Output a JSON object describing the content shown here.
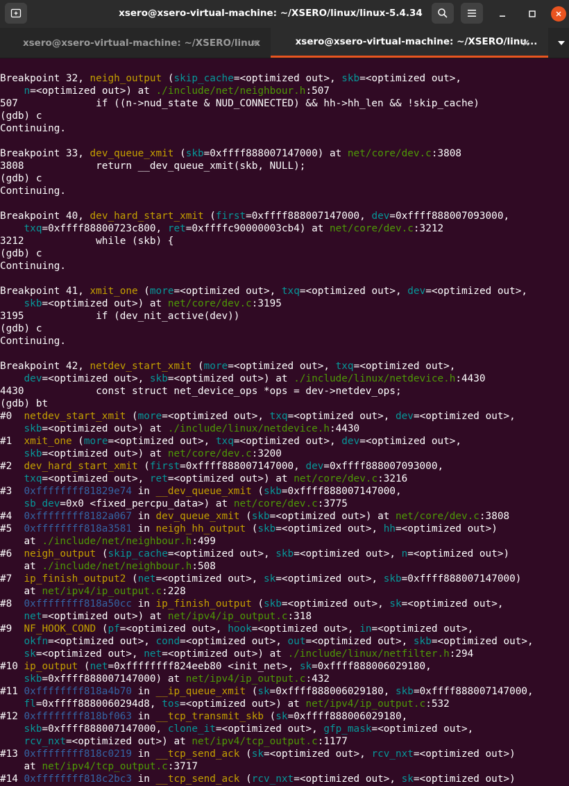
{
  "window": {
    "title": "xsero@xsero-virtual-machine: ~/XSERO/linux/linux-5.4.34",
    "new_tab_icon": "new-tab-icon",
    "search_icon": "search-icon",
    "menu_icon": "hamburger-menu-icon",
    "minimize_icon": "minimize-icon",
    "maximize_icon": "maximize-icon",
    "close_icon": "close-icon",
    "close_color": "#e95420"
  },
  "tabs": [
    {
      "label": "xsero@xsero-virtual-machine: ~/XSERO/linux",
      "close": "×",
      "active": false
    },
    {
      "label": "xsero@xsero-virtual-machine: ~/XSERO/linu...",
      "close": "×",
      "active": true
    }
  ],
  "tab_dropdown_icon": "chevron-down-icon",
  "terminal": {
    "colors": {
      "background": "#300a24",
      "text": "#ffffff",
      "function": "#c4a000",
      "argument": "#06989a",
      "file": "#4e9a06",
      "address": "#3465a4"
    },
    "lines": [
      [
        {
          "t": "Breakpoint 32, "
        },
        {
          "t": "neigh_output",
          "c": "fn"
        },
        {
          "t": " ("
        },
        {
          "t": "skip_cache",
          "c": "arg"
        },
        {
          "t": "=<optimized out>, "
        },
        {
          "t": "skb",
          "c": "arg"
        },
        {
          "t": "=<optimized out>,"
        }
      ],
      [
        {
          "t": "    "
        },
        {
          "t": "n",
          "c": "arg"
        },
        {
          "t": "=<optimized out>) at "
        },
        {
          "t": "./include/net/neighbour.h",
          "c": "file"
        },
        {
          "t": ":507"
        }
      ],
      [
        {
          "t": "507             if ((n->nud_state & NUD_CONNECTED) && hh->hh_len && !skip_cache)"
        }
      ],
      [
        {
          "t": "(gdb) c"
        }
      ],
      [
        {
          "t": "Continuing."
        }
      ],
      [
        {
          "t": ""
        }
      ],
      [
        {
          "t": "Breakpoint 33, "
        },
        {
          "t": "dev_queue_xmit",
          "c": "fn"
        },
        {
          "t": " ("
        },
        {
          "t": "skb",
          "c": "arg"
        },
        {
          "t": "=0xffff888007147000) at "
        },
        {
          "t": "net/core/dev.c",
          "c": "file"
        },
        {
          "t": ":3808"
        }
      ],
      [
        {
          "t": "3808            return __dev_queue_xmit(skb, NULL);"
        }
      ],
      [
        {
          "t": "(gdb) c"
        }
      ],
      [
        {
          "t": "Continuing."
        }
      ],
      [
        {
          "t": ""
        }
      ],
      [
        {
          "t": "Breakpoint 40, "
        },
        {
          "t": "dev_hard_start_xmit",
          "c": "fn"
        },
        {
          "t": " ("
        },
        {
          "t": "first",
          "c": "arg"
        },
        {
          "t": "=0xffff888007147000, "
        },
        {
          "t": "dev",
          "c": "arg"
        },
        {
          "t": "=0xffff888007093000,"
        }
      ],
      [
        {
          "t": "    "
        },
        {
          "t": "txq",
          "c": "arg"
        },
        {
          "t": "=0xffff88800723c800, "
        },
        {
          "t": "ret",
          "c": "arg"
        },
        {
          "t": "=0xffffc90000003cb4) at "
        },
        {
          "t": "net/core/dev.c",
          "c": "file"
        },
        {
          "t": ":3212"
        }
      ],
      [
        {
          "t": "3212            while (skb) {"
        }
      ],
      [
        {
          "t": "(gdb) c"
        }
      ],
      [
        {
          "t": "Continuing."
        }
      ],
      [
        {
          "t": ""
        }
      ],
      [
        {
          "t": "Breakpoint 41, "
        },
        {
          "t": "xmit_one",
          "c": "fn"
        },
        {
          "t": " ("
        },
        {
          "t": "more",
          "c": "arg"
        },
        {
          "t": "=<optimized out>, "
        },
        {
          "t": "txq",
          "c": "arg"
        },
        {
          "t": "=<optimized out>, "
        },
        {
          "t": "dev",
          "c": "arg"
        },
        {
          "t": "=<optimized out>,"
        }
      ],
      [
        {
          "t": "    "
        },
        {
          "t": "skb",
          "c": "arg"
        },
        {
          "t": "=<optimized out>) at "
        },
        {
          "t": "net/core/dev.c",
          "c": "file"
        },
        {
          "t": ":3195"
        }
      ],
      [
        {
          "t": "3195            if (dev_nit_active(dev))"
        }
      ],
      [
        {
          "t": "(gdb) c"
        }
      ],
      [
        {
          "t": "Continuing."
        }
      ],
      [
        {
          "t": ""
        }
      ],
      [
        {
          "t": "Breakpoint 42, "
        },
        {
          "t": "netdev_start_xmit",
          "c": "fn"
        },
        {
          "t": " ("
        },
        {
          "t": "more",
          "c": "arg"
        },
        {
          "t": "=<optimized out>, "
        },
        {
          "t": "txq",
          "c": "arg"
        },
        {
          "t": "=<optimized out>,"
        }
      ],
      [
        {
          "t": "    "
        },
        {
          "t": "dev",
          "c": "arg"
        },
        {
          "t": "=<optimized out>, "
        },
        {
          "t": "skb",
          "c": "arg"
        },
        {
          "t": "=<optimized out>) at "
        },
        {
          "t": "./include/linux/netdevice.h",
          "c": "file"
        },
        {
          "t": ":4430"
        }
      ],
      [
        {
          "t": "4430            const struct net_device_ops *ops = dev->netdev_ops;"
        }
      ],
      [
        {
          "t": "(gdb) bt"
        }
      ],
      [
        {
          "t": "#0  "
        },
        {
          "t": "netdev_start_xmit",
          "c": "fn"
        },
        {
          "t": " ("
        },
        {
          "t": "more",
          "c": "arg"
        },
        {
          "t": "=<optimized out>, "
        },
        {
          "t": "txq",
          "c": "arg"
        },
        {
          "t": "=<optimized out>, "
        },
        {
          "t": "dev",
          "c": "arg"
        },
        {
          "t": "=<optimized out>,"
        }
      ],
      [
        {
          "t": "    "
        },
        {
          "t": "skb",
          "c": "arg"
        },
        {
          "t": "=<optimized out>) at "
        },
        {
          "t": "./include/linux/netdevice.h",
          "c": "file"
        },
        {
          "t": ":4430"
        }
      ],
      [
        {
          "t": "#1  "
        },
        {
          "t": "xmit_one",
          "c": "fn"
        },
        {
          "t": " ("
        },
        {
          "t": "more",
          "c": "arg"
        },
        {
          "t": "=<optimized out>, "
        },
        {
          "t": "txq",
          "c": "arg"
        },
        {
          "t": "=<optimized out>, "
        },
        {
          "t": "dev",
          "c": "arg"
        },
        {
          "t": "=<optimized out>,"
        }
      ],
      [
        {
          "t": "    "
        },
        {
          "t": "skb",
          "c": "arg"
        },
        {
          "t": "=<optimized out>) at "
        },
        {
          "t": "net/core/dev.c",
          "c": "file"
        },
        {
          "t": ":3200"
        }
      ],
      [
        {
          "t": "#2  "
        },
        {
          "t": "dev_hard_start_xmit",
          "c": "fn"
        },
        {
          "t": " ("
        },
        {
          "t": "first",
          "c": "arg"
        },
        {
          "t": "=0xffff888007147000, "
        },
        {
          "t": "dev",
          "c": "arg"
        },
        {
          "t": "=0xffff888007093000,"
        }
      ],
      [
        {
          "t": "    "
        },
        {
          "t": "txq",
          "c": "arg"
        },
        {
          "t": "=<optimized out>, "
        },
        {
          "t": "ret",
          "c": "arg"
        },
        {
          "t": "=<optimized out>) at "
        },
        {
          "t": "net/core/dev.c",
          "c": "file"
        },
        {
          "t": ":3216"
        }
      ],
      [
        {
          "t": "#3  "
        },
        {
          "t": "0xffffffff81829e74",
          "c": "addr"
        },
        {
          "t": " in "
        },
        {
          "t": "__dev_queue_xmit",
          "c": "fn"
        },
        {
          "t": " ("
        },
        {
          "t": "skb",
          "c": "arg"
        },
        {
          "t": "=0xffff888007147000,"
        }
      ],
      [
        {
          "t": "    "
        },
        {
          "t": "sb_dev",
          "c": "arg"
        },
        {
          "t": "=0x0 <fixed_percpu_data>) at "
        },
        {
          "t": "net/core/dev.c",
          "c": "file"
        },
        {
          "t": ":3775"
        }
      ],
      [
        {
          "t": "#4  "
        },
        {
          "t": "0xffffffff8182a067",
          "c": "addr"
        },
        {
          "t": " in "
        },
        {
          "t": "dev_queue_xmit",
          "c": "fn"
        },
        {
          "t": " ("
        },
        {
          "t": "skb",
          "c": "arg"
        },
        {
          "t": "=<optimized out>) at "
        },
        {
          "t": "net/core/dev.c",
          "c": "file"
        },
        {
          "t": ":3808"
        }
      ],
      [
        {
          "t": "#5  "
        },
        {
          "t": "0xffffffff818a3581",
          "c": "addr"
        },
        {
          "t": " in "
        },
        {
          "t": "neigh_hh_output",
          "c": "fn"
        },
        {
          "t": " ("
        },
        {
          "t": "skb",
          "c": "arg"
        },
        {
          "t": "=<optimized out>, "
        },
        {
          "t": "hh",
          "c": "arg"
        },
        {
          "t": "=<optimized out>)"
        }
      ],
      [
        {
          "t": "    at "
        },
        {
          "t": "./include/net/neighbour.h",
          "c": "file"
        },
        {
          "t": ":499"
        }
      ],
      [
        {
          "t": "#6  "
        },
        {
          "t": "neigh_output",
          "c": "fn"
        },
        {
          "t": " ("
        },
        {
          "t": "skip_cache",
          "c": "arg"
        },
        {
          "t": "=<optimized out>, "
        },
        {
          "t": "skb",
          "c": "arg"
        },
        {
          "t": "=<optimized out>, "
        },
        {
          "t": "n",
          "c": "arg"
        },
        {
          "t": "=<optimized out>)"
        }
      ],
      [
        {
          "t": "    at "
        },
        {
          "t": "./include/net/neighbour.h",
          "c": "file"
        },
        {
          "t": ":508"
        }
      ],
      [
        {
          "t": "#7  "
        },
        {
          "t": "ip_finish_output2",
          "c": "fn"
        },
        {
          "t": " ("
        },
        {
          "t": "net",
          "c": "arg"
        },
        {
          "t": "=<optimized out>, "
        },
        {
          "t": "sk",
          "c": "arg"
        },
        {
          "t": "=<optimized out>, "
        },
        {
          "t": "skb",
          "c": "arg"
        },
        {
          "t": "=0xffff888007147000)"
        }
      ],
      [
        {
          "t": "    at "
        },
        {
          "t": "net/ipv4/ip_output.c",
          "c": "file"
        },
        {
          "t": ":228"
        }
      ],
      [
        {
          "t": "#8  "
        },
        {
          "t": "0xffffffff818a50cc",
          "c": "addr"
        },
        {
          "t": " in "
        },
        {
          "t": "ip_finish_output",
          "c": "fn"
        },
        {
          "t": " ("
        },
        {
          "t": "skb",
          "c": "arg"
        },
        {
          "t": "=<optimized out>, "
        },
        {
          "t": "sk",
          "c": "arg"
        },
        {
          "t": "=<optimized out>,"
        }
      ],
      [
        {
          "t": "    "
        },
        {
          "t": "net",
          "c": "arg"
        },
        {
          "t": "=<optimized out>) at "
        },
        {
          "t": "net/ipv4/ip_output.c",
          "c": "file"
        },
        {
          "t": ":318"
        }
      ],
      [
        {
          "t": "#9  "
        },
        {
          "t": "NF_HOOK_COND",
          "c": "fn"
        },
        {
          "t": " ("
        },
        {
          "t": "pf",
          "c": "arg"
        },
        {
          "t": "=<optimized out>, "
        },
        {
          "t": "hook",
          "c": "arg"
        },
        {
          "t": "=<optimized out>, "
        },
        {
          "t": "in",
          "c": "arg"
        },
        {
          "t": "=<optimized out>,"
        }
      ],
      [
        {
          "t": "    "
        },
        {
          "t": "okfn",
          "c": "arg"
        },
        {
          "t": "=<optimized out>, "
        },
        {
          "t": "cond",
          "c": "arg"
        },
        {
          "t": "=<optimized out>, "
        },
        {
          "t": "out",
          "c": "arg"
        },
        {
          "t": "=<optimized out>, "
        },
        {
          "t": "skb",
          "c": "arg"
        },
        {
          "t": "=<optimized out>,"
        }
      ],
      [
        {
          "t": "    "
        },
        {
          "t": "sk",
          "c": "arg"
        },
        {
          "t": "=<optimized out>, "
        },
        {
          "t": "net",
          "c": "arg"
        },
        {
          "t": "=<optimized out>) at "
        },
        {
          "t": "./include/linux/netfilter.h",
          "c": "file"
        },
        {
          "t": ":294"
        }
      ],
      [
        {
          "t": "#10 "
        },
        {
          "t": "ip_output",
          "c": "fn"
        },
        {
          "t": " ("
        },
        {
          "t": "net",
          "c": "arg"
        },
        {
          "t": "=0xffffffff824eeb80 <init_net>, "
        },
        {
          "t": "sk",
          "c": "arg"
        },
        {
          "t": "=0xffff888006029180,"
        }
      ],
      [
        {
          "t": "    "
        },
        {
          "t": "skb",
          "c": "arg"
        },
        {
          "t": "=0xffff888007147000) at "
        },
        {
          "t": "net/ipv4/ip_output.c",
          "c": "file"
        },
        {
          "t": ":432"
        }
      ],
      [
        {
          "t": "#11 "
        },
        {
          "t": "0xffffffff818a4b70",
          "c": "addr"
        },
        {
          "t": " in "
        },
        {
          "t": "__ip_queue_xmit",
          "c": "fn"
        },
        {
          "t": " ("
        },
        {
          "t": "sk",
          "c": "arg"
        },
        {
          "t": "=0xffff888006029180, "
        },
        {
          "t": "skb",
          "c": "arg"
        },
        {
          "t": "=0xffff888007147000,"
        }
      ],
      [
        {
          "t": "    "
        },
        {
          "t": "fl",
          "c": "arg"
        },
        {
          "t": "=0xffff8880060294d8, "
        },
        {
          "t": "tos",
          "c": "arg"
        },
        {
          "t": "=<optimized out>) at "
        },
        {
          "t": "net/ipv4/ip_output.c",
          "c": "file"
        },
        {
          "t": ":532"
        }
      ],
      [
        {
          "t": "#12 "
        },
        {
          "t": "0xffffffff818bf063",
          "c": "addr"
        },
        {
          "t": " in "
        },
        {
          "t": "__tcp_transmit_skb",
          "c": "fn"
        },
        {
          "t": " ("
        },
        {
          "t": "sk",
          "c": "arg"
        },
        {
          "t": "=0xffff888006029180,"
        }
      ],
      [
        {
          "t": "    "
        },
        {
          "t": "skb",
          "c": "arg"
        },
        {
          "t": "=0xffff888007147000, "
        },
        {
          "t": "clone_it",
          "c": "arg"
        },
        {
          "t": "=<optimized out>, "
        },
        {
          "t": "gfp_mask",
          "c": "arg"
        },
        {
          "t": "=<optimized out>,"
        }
      ],
      [
        {
          "t": "    "
        },
        {
          "t": "rcv_nxt",
          "c": "arg"
        },
        {
          "t": "=<optimized out>) at "
        },
        {
          "t": "net/ipv4/tcp_output.c",
          "c": "file"
        },
        {
          "t": ":1177"
        }
      ],
      [
        {
          "t": "#13 "
        },
        {
          "t": "0xffffffff818c0219",
          "c": "addr"
        },
        {
          "t": " in "
        },
        {
          "t": "__tcp_send_ack",
          "c": "fn"
        },
        {
          "t": " ("
        },
        {
          "t": "sk",
          "c": "arg"
        },
        {
          "t": "=<optimized out>, "
        },
        {
          "t": "rcv_nxt",
          "c": "arg"
        },
        {
          "t": "=<optimized out>)"
        }
      ],
      [
        {
          "t": "    at "
        },
        {
          "t": "net/ipv4/tcp_output.c",
          "c": "file"
        },
        {
          "t": ":3717"
        }
      ],
      [
        {
          "t": "#14 "
        },
        {
          "t": "0xffffffff818c2bc3",
          "c": "addr"
        },
        {
          "t": " in "
        },
        {
          "t": "__tcp_send_ack",
          "c": "fn"
        },
        {
          "t": " ("
        },
        {
          "t": "rcv_nxt",
          "c": "arg"
        },
        {
          "t": "=<optimized out>, "
        },
        {
          "t": "sk",
          "c": "arg"
        },
        {
          "t": "=<optimized out>)"
        }
      ]
    ]
  }
}
